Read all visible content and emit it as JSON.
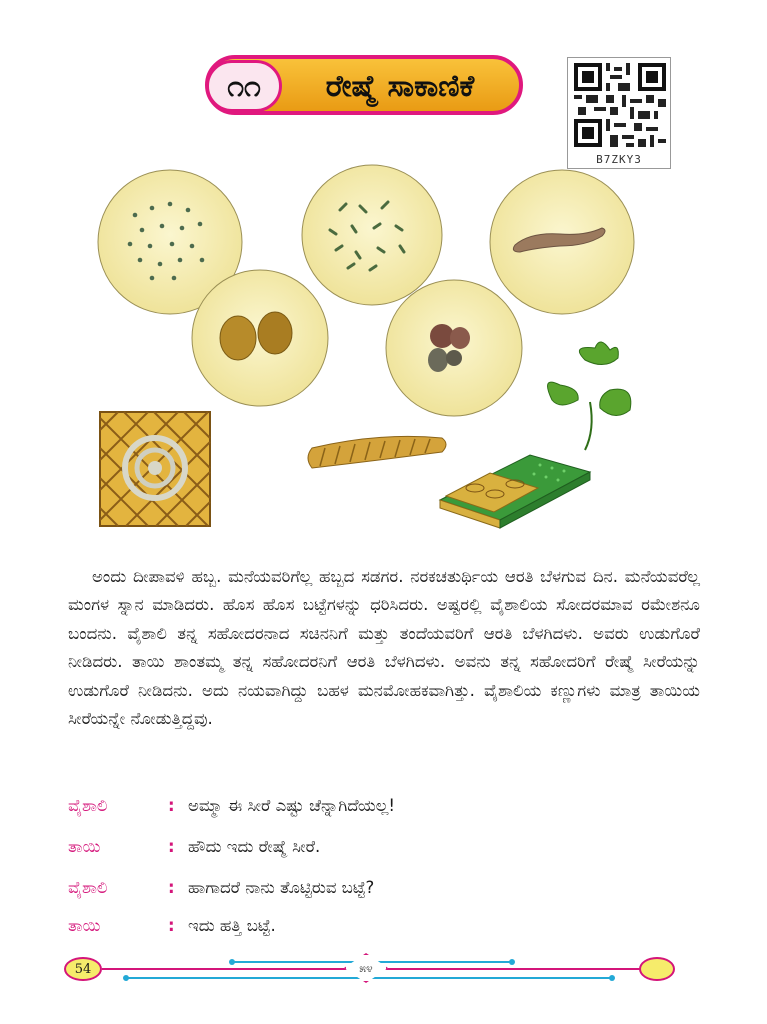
{
  "chapter": {
    "number": "೧೧",
    "title": "ರೇಷ್ಮೆ ಸಾಕಾಣಿಕೆ"
  },
  "qr": {
    "code": "B7ZKY3"
  },
  "paragraph": "ಅಂದು ದೀಪಾವಳಿ ಹಬ್ಬ. ಮನೆಯವರಿಗೆಲ್ಲ ಹಬ್ಬದ ಸಡಗರ. ನರಕಚತುರ್ಥಿಯ ಆರತಿ ಬೆಳಗುವ ದಿನ. ಮನೆಯವರೆಲ್ಲ ಮಂಗಳ ಸ್ನಾನ ಮಾಡಿದರು. ಹೊಸ ಹೊಸ ಬಟ್ಟೆಗಳನ್ನು ಧರಿಸಿದರು. ಅಷ್ಟರಲ್ಲಿ ವೈಶಾಲಿಯ ಸೋದರಮಾವ ರಮೇಶನೂ ಬಂದನು. ವೈಶಾಲಿ ತನ್ನ ಸಹೋದರನಾದ ಸಚಿನನಿಗೆ ಮತ್ತು ತಂದೆಯವರಿಗೆ ಆರತಿ ಬೆಳಗಿದಳು. ಅವರು ಉಡುಗೊರೆ ನೀಡಿದರು. ತಾಯಿ ಶಾಂತಮ್ಮ ತನ್ನ ಸಹೋದರನಿಗೆ ಆರತಿ ಬೆಳಗಿದಳು. ಅವನು ತನ್ನ ಸಹೋದರಿಗೆ ರೇಷ್ಮೆ ಸೀರೆಯನ್ನು ಉಡುಗೊರೆ ನೀಡಿದನು. ಅದು ನಯವಾಗಿದ್ದು ಬಹಳ ಮನಮೋಹಕವಾಗಿತ್ತು. ವೈಶಾಲಿಯ ಕಣ್ಣುಗಳು ಮಾತ್ರ ತಾಯಿಯ ಸೀರೆಯನ್ನೇ ನೋಡುತ್ತಿದ್ದವು.",
  "dialogue": [
    {
      "speaker": "ವೈಶಾಲಿ",
      "colon": ":",
      "text": "ಅಮ್ಮಾ ಈ ಸೀರೆ ಎಷ್ಟು ಚೆನ್ನಾಗಿದೆಯಲ್ಲ!"
    },
    {
      "speaker": "ತಾಯಿ",
      "colon": ":",
      "text": "ಹೌದು ಇದು ರೇಷ್ಮೆ ಸೀರೆ."
    },
    {
      "speaker": "ವೈಶಾಲಿ",
      "colon": ":",
      "text": "ಹಾಗಾದರೆ ನಾನು ತೊಟ್ಟಿರುವ ಬಟ್ಟೆ?"
    },
    {
      "speaker": "ತಾಯಿ",
      "colon": ":",
      "text": "ಇದು ಹತ್ತಿ ಬಟ್ಟೆ."
    }
  ],
  "footer": {
    "page_number": "54",
    "ornament": "೫೪"
  },
  "colors": {
    "accent_pink": "#e0187e",
    "banner_gold": "#f2b027",
    "footer_blue": "#23a9d6",
    "page_badge": "#f6ec6b"
  }
}
